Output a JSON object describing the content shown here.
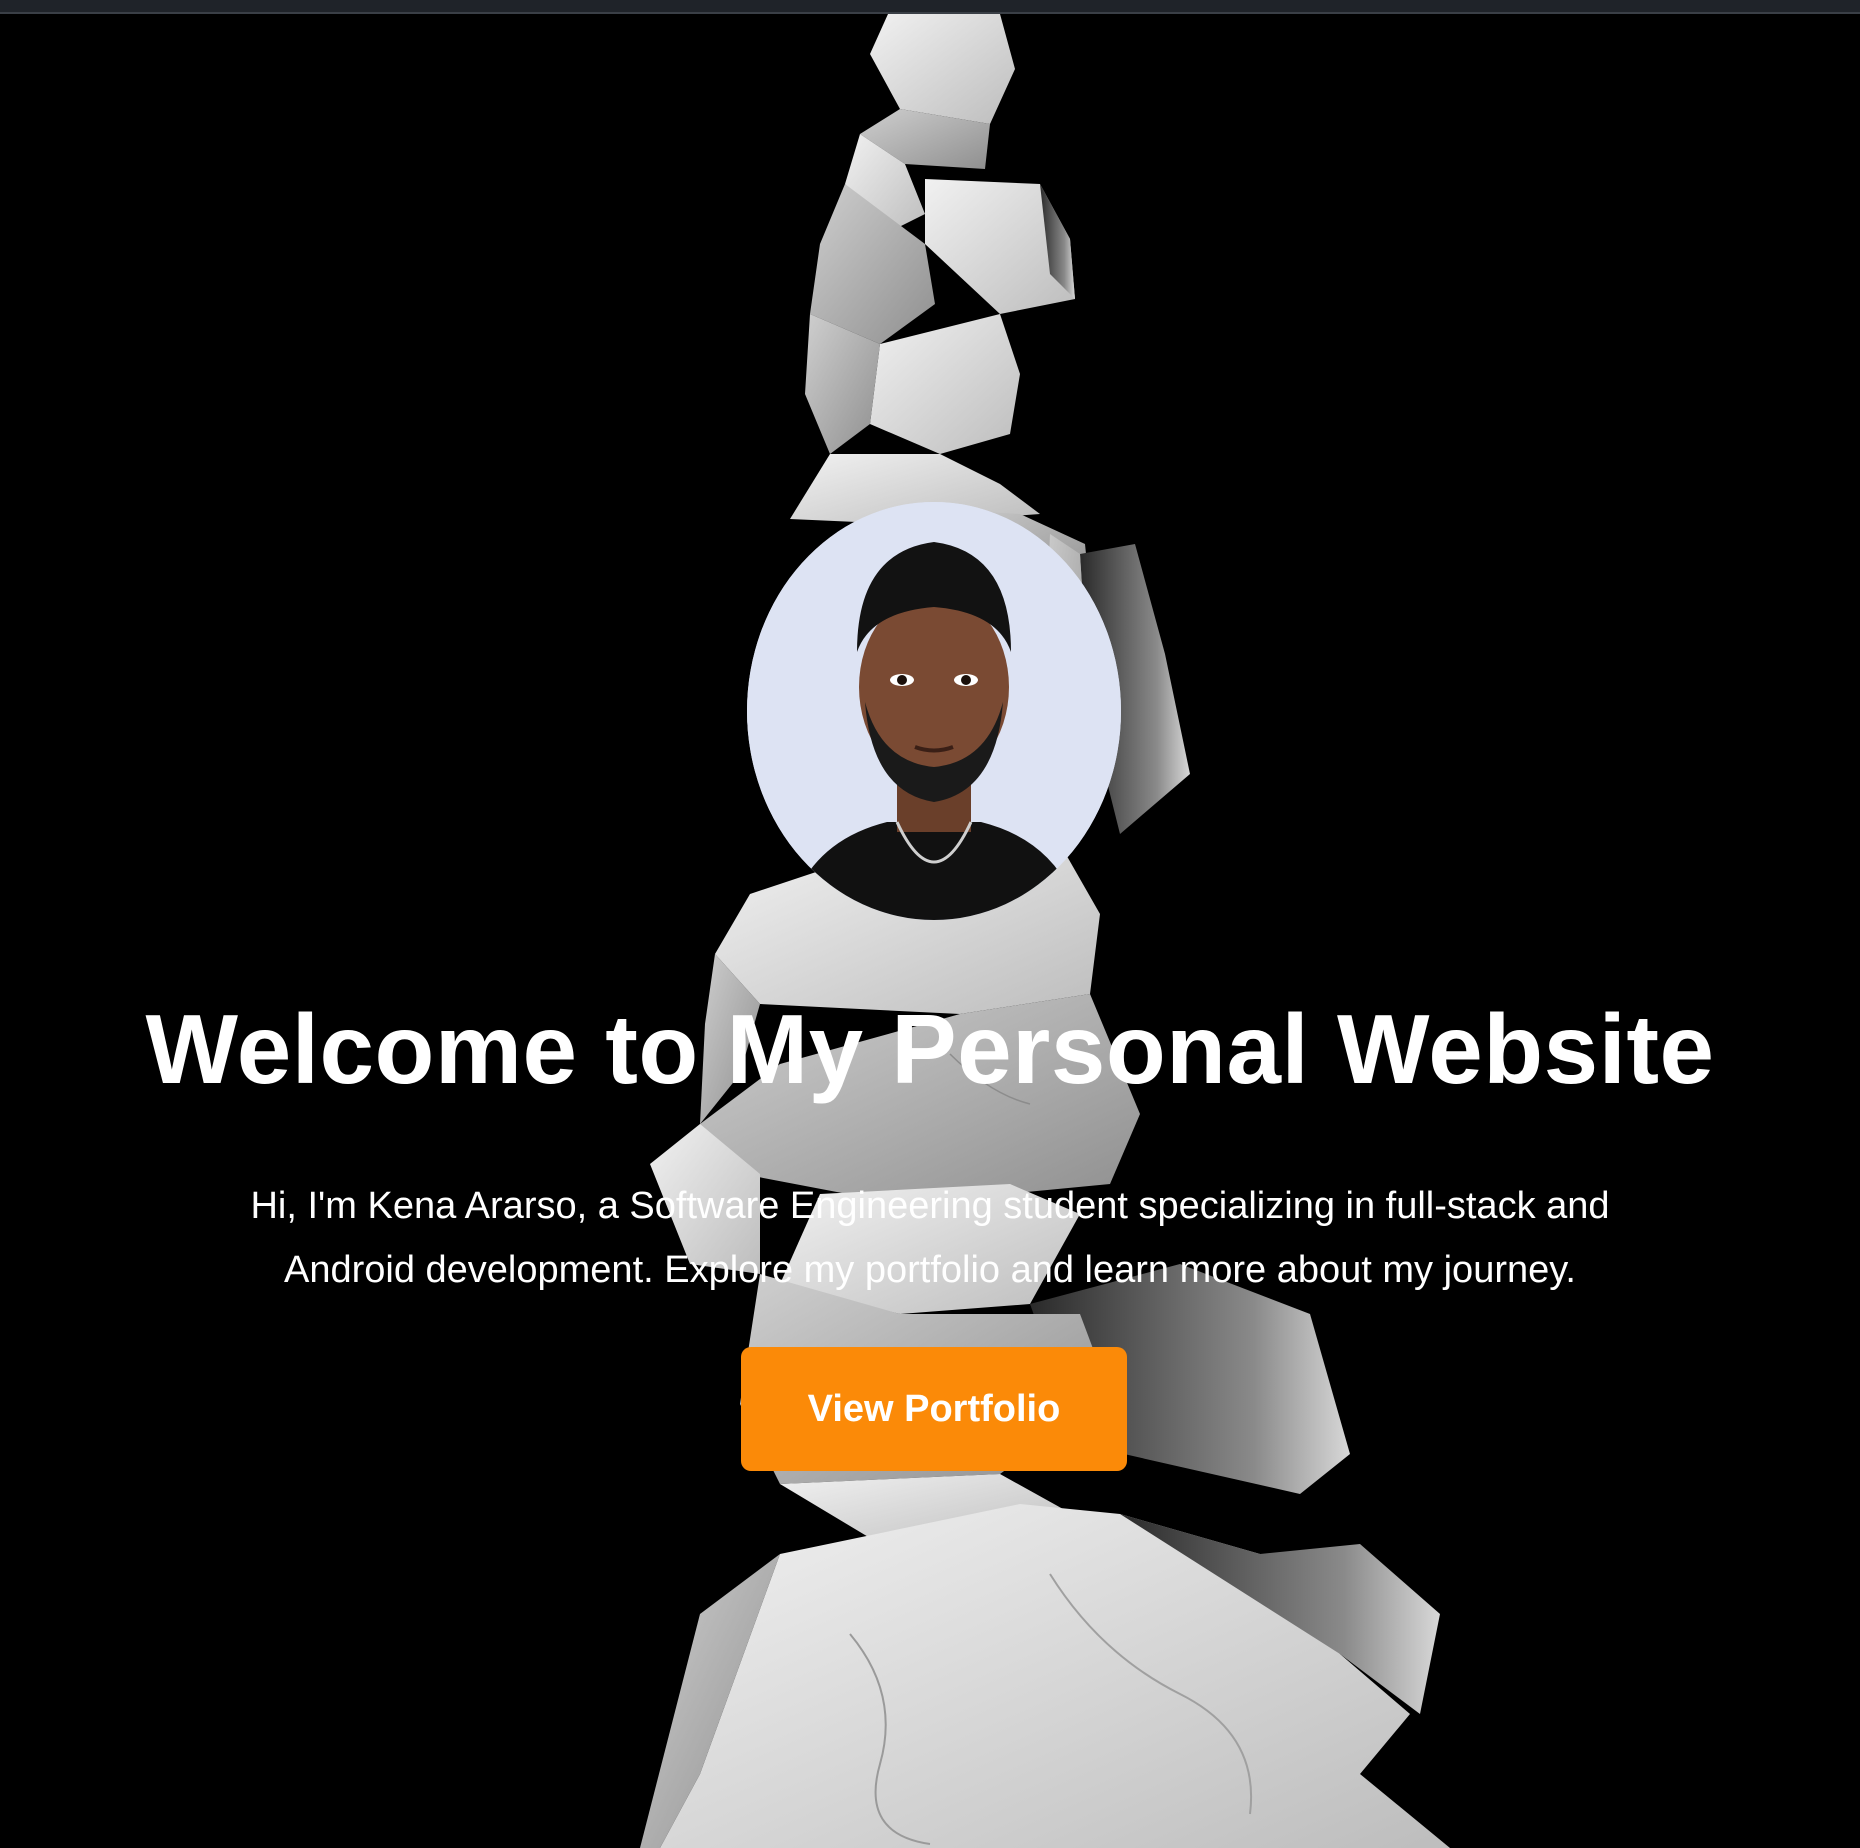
{
  "hero": {
    "title": "Welcome to My Personal Website",
    "intro": "Hi, I'm Kena Ararso, a Software Engineering student specializing in full-stack and Android development. Explore my portfolio and learn more about my journey.",
    "cta_label": "View Portfolio"
  },
  "colors": {
    "background": "#000000",
    "accent": "#fb8a08",
    "text": "#ffffff",
    "avatar_bg": "#dde3f3"
  }
}
